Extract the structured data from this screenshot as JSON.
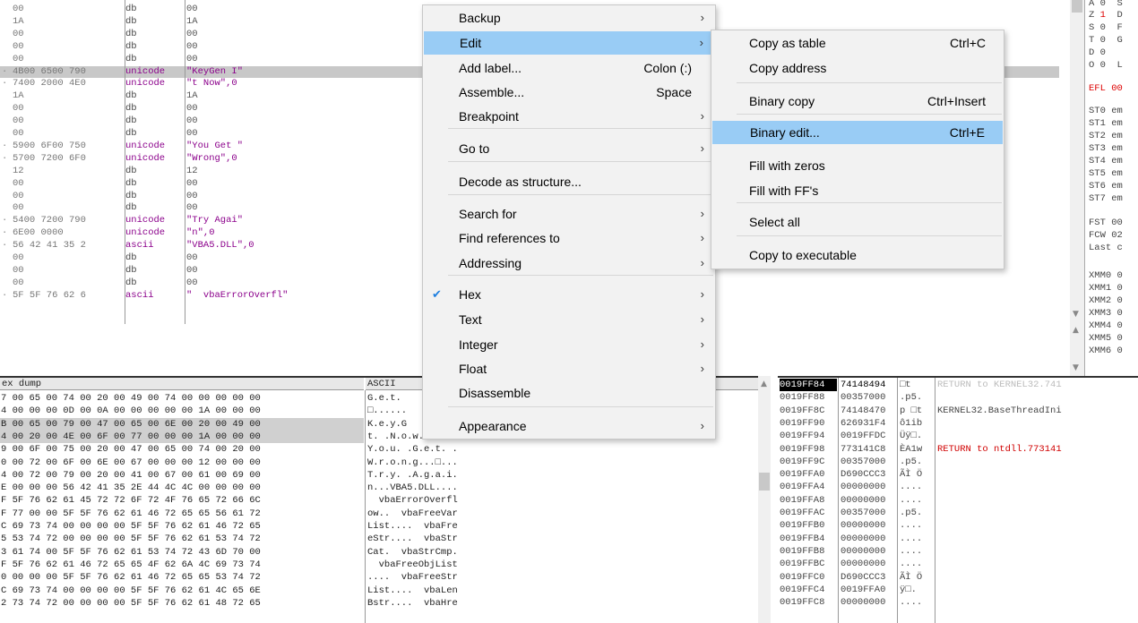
{
  "disasm": {
    "rows": [
      {
        "a": "00",
        "b": "db",
        "c": "00",
        "sel": false,
        "dot": false
      },
      {
        "a": "1A",
        "b": "db",
        "c": "1A",
        "sel": false,
        "dot": false
      },
      {
        "a": "00",
        "b": "db",
        "c": "00",
        "sel": false,
        "dot": false
      },
      {
        "a": "00",
        "b": "db",
        "c": "00",
        "sel": false,
        "dot": false
      },
      {
        "a": "00",
        "b": "db",
        "c": "00",
        "sel": false,
        "dot": false
      },
      {
        "a": "4B00 6500 790",
        "b": "unicode",
        "c": "\"KeyGen I\"",
        "sel": true,
        "dot": true
      },
      {
        "a": "7400 2000 4E0",
        "b": "unicode",
        "c": "\"t Now\",0",
        "sel": false,
        "dot": true
      },
      {
        "a": "1A",
        "b": "db",
        "c": "1A",
        "sel": false,
        "dot": false
      },
      {
        "a": "00",
        "b": "db",
        "c": "00",
        "sel": false,
        "dot": false
      },
      {
        "a": "00",
        "b": "db",
        "c": "00",
        "sel": false,
        "dot": false
      },
      {
        "a": "00",
        "b": "db",
        "c": "00",
        "sel": false,
        "dot": false
      },
      {
        "a": "5900 6F00 750",
        "b": "unicode",
        "c": "\"You Get \"",
        "sel": false,
        "dot": true
      },
      {
        "a": "5700 7200 6F0",
        "b": "unicode",
        "c": "\"Wrong\",0",
        "sel": false,
        "dot": true
      },
      {
        "a": "12",
        "b": "db",
        "c": "12",
        "sel": false,
        "dot": false
      },
      {
        "a": "00",
        "b": "db",
        "c": "00",
        "sel": false,
        "dot": false
      },
      {
        "a": "00",
        "b": "db",
        "c": "00",
        "sel": false,
        "dot": false
      },
      {
        "a": "00",
        "b": "db",
        "c": "00",
        "sel": false,
        "dot": false
      },
      {
        "a": "5400 7200 790",
        "b": "unicode",
        "c": "\"Try Agai\"",
        "sel": false,
        "dot": true
      },
      {
        "a": "6E00 0000",
        "b": "unicode",
        "c": "\"n\",0",
        "sel": false,
        "dot": true
      },
      {
        "a": "56 42 41 35 2",
        "b": "ascii",
        "c": "\"VBA5.DLL\",0",
        "sel": false,
        "dot": true
      },
      {
        "a": "00",
        "b": "db",
        "c": "00",
        "sel": false,
        "dot": false
      },
      {
        "a": "00",
        "b": "db",
        "c": "00",
        "sel": false,
        "dot": false
      },
      {
        "a": "00",
        "b": "db",
        "c": "00",
        "sel": false,
        "dot": false
      },
      {
        "a": "5F 5F 76 62 6",
        "b": "ascii",
        "c": "\"  vbaErrorOverfl\"",
        "sel": false,
        "dot": true
      }
    ]
  },
  "registers": {
    "rows": [
      {
        "t": "A 0  S",
        "red": false
      },
      {
        "t": "Z 1  D",
        "red": false,
        "z": true
      },
      {
        "t": "S 0  F",
        "red": false
      },
      {
        "t": "T 0  G",
        "red": false
      },
      {
        "t": "D 0",
        "red": false
      },
      {
        "t": "O 0  L",
        "red": false
      },
      {
        "t": "EFL 00",
        "red": true
      },
      {
        "t": "ST0 em",
        "red": false
      },
      {
        "t": "ST1 em",
        "red": false
      },
      {
        "t": "ST2 em",
        "red": false
      },
      {
        "t": "ST3 em",
        "red": false
      },
      {
        "t": "ST4 em",
        "red": false
      },
      {
        "t": "ST5 em",
        "red": false
      },
      {
        "t": "ST6 em",
        "red": false
      },
      {
        "t": "ST7 em",
        "red": false
      },
      {
        "t": "FST 00",
        "red": false
      },
      {
        "t": "FCW 02",
        "red": false
      },
      {
        "t": "Last c",
        "red": false
      },
      {
        "t": "XMM0 0",
        "red": false
      },
      {
        "t": "XMM1 0",
        "red": false
      },
      {
        "t": "XMM2 0",
        "red": false
      },
      {
        "t": "XMM3 0",
        "red": false
      },
      {
        "t": "XMM4 0",
        "red": false
      },
      {
        "t": "XMM5 0",
        "red": false
      },
      {
        "t": "XMM6 0",
        "red": false
      }
    ]
  },
  "hexdump": {
    "header_hex": "ex dump",
    "header_ascii": "ASCII",
    "rows": [
      {
        "h": "7 00 65 00 74 00 20 00 49 00 74 00 00 00 00 00",
        "a": "G.e.t. ",
        "sel": false
      },
      {
        "h": "4 00 00 00 0D 00 0A 00 00 00 00 00 1A 00 00 00",
        "a": "□......",
        "sel": false
      },
      {
        "h": "B 00 65 00 79 00 47 00 65 00 6E 00 20 00 49 00",
        "a": "K.e.y.G",
        "sel": true
      },
      {
        "h": "4 00 20 00 4E 00 6F 00 77 00 00 00 1A 00 00 00",
        "a": "t. .N.o.w...□...",
        "sel": true
      },
      {
        "h": "9 00 6F 00 75 00 20 00 47 00 65 00 74 00 20 00",
        "a": "Y.o.u. .G.e.t. .",
        "sel": false
      },
      {
        "h": "0 00 72 00 6F 00 6E 00 67 00 00 00 12 00 00 00",
        "a": "W.r.o.n.g...□...",
        "sel": false
      },
      {
        "h": "4 00 72 00 79 00 20 00 41 00 67 00 61 00 69 00",
        "a": "T.r.y. .A.g.a.i.",
        "sel": false
      },
      {
        "h": "E 00 00 00 56 42 41 35 2E 44 4C 4C 00 00 00 00",
        "a": "n...VBA5.DLL....",
        "sel": false
      },
      {
        "h": "F 5F 76 62 61 45 72 72 6F 72 4F 76 65 72 66 6C",
        "a": "  vbaErrorOverfl",
        "sel": false
      },
      {
        "h": "F 77 00 00 5F 5F 76 62 61 46 72 65 65 56 61 72",
        "a": "ow..  vbaFreeVar",
        "sel": false
      },
      {
        "h": "C 69 73 74 00 00 00 00 5F 5F 76 62 61 46 72 65",
        "a": "List....  vbaFre",
        "sel": false
      },
      {
        "h": "5 53 74 72 00 00 00 00 5F 5F 76 62 61 53 74 72",
        "a": "eStr....  vbaStr",
        "sel": false
      },
      {
        "h": "3 61 74 00 5F 5F 76 62 61 53 74 72 43 6D 70 00",
        "a": "Cat.  vbaStrCmp.",
        "sel": false
      },
      {
        "h": "F 5F 76 62 61 46 72 65 65 4F 62 6A 4C 69 73 74",
        "a": "  vbaFreeObjList",
        "sel": false
      },
      {
        "h": "0 00 00 00 5F 5F 76 62 61 46 72 65 65 53 74 72",
        "a": "....  vbaFreeStr",
        "sel": false
      },
      {
        "h": "C 69 73 74 00 00 00 00 5F 5F 76 62 61 4C 65 6E",
        "a": "List....  vbaLen",
        "sel": false
      },
      {
        "h": "2 73 74 72 00 00 00 00 5F 5F 76 62 61 48 72 65",
        "a": "Bstr....  vbaHre",
        "sel": false
      }
    ]
  },
  "stack": {
    "rows": [
      {
        "addr": "0019FF84",
        "val": "74148494",
        "asc": "□t",
        "com": "RETURN to KERNEL32.741",
        "cls": "gray",
        "cur": true
      },
      {
        "addr": "0019FF88",
        "val": "00357000",
        "asc": ".p5.",
        "com": "",
        "cls": ""
      },
      {
        "addr": "0019FF8C",
        "val": "74148470",
        "asc": "p □t",
        "com": "KERNEL32.BaseThreadIni",
        "cls": ""
      },
      {
        "addr": "0019FF90",
        "val": "626931F4",
        "asc": "ô1ib",
        "com": "",
        "cls": ""
      },
      {
        "addr": "0019FF94",
        "val": "0019FFDC",
        "asc": "Üÿ□.",
        "com": "",
        "cls": ""
      },
      {
        "addr": "0019FF98",
        "val": "773141C8",
        "asc": "ÈA1w",
        "com": "RETURN to ntdll.773141",
        "cls": "red"
      },
      {
        "addr": "0019FF9C",
        "val": "00357000",
        "asc": ".p5.",
        "com": "",
        "cls": ""
      },
      {
        "addr": "0019FFA0",
        "val": "D690CCC3",
        "asc": "ÃÌ Ö",
        "com": "",
        "cls": ""
      },
      {
        "addr": "0019FFA4",
        "val": "00000000",
        "asc": "....",
        "com": "",
        "cls": ""
      },
      {
        "addr": "0019FFA8",
        "val": "00000000",
        "asc": "....",
        "com": "",
        "cls": ""
      },
      {
        "addr": "0019FFAC",
        "val": "00357000",
        "asc": ".p5.",
        "com": "",
        "cls": ""
      },
      {
        "addr": "0019FFB0",
        "val": "00000000",
        "asc": "....",
        "com": "",
        "cls": ""
      },
      {
        "addr": "0019FFB4",
        "val": "00000000",
        "asc": "....",
        "com": "",
        "cls": ""
      },
      {
        "addr": "0019FFB8",
        "val": "00000000",
        "asc": "....",
        "com": "",
        "cls": ""
      },
      {
        "addr": "0019FFBC",
        "val": "00000000",
        "asc": "....",
        "com": "",
        "cls": ""
      },
      {
        "addr": "0019FFC0",
        "val": "D690CCC3",
        "asc": "ÃÌ Ö",
        "com": "",
        "cls": ""
      },
      {
        "addr": "0019FFC4",
        "val": "0019FFA0",
        "asc": "ÿ□.",
        "com": "",
        "cls": ""
      },
      {
        "addr": "0019FFC8",
        "val": "00000000",
        "asc": "....",
        "com": "",
        "cls": ""
      }
    ]
  },
  "context_menu": {
    "items": [
      {
        "label": "Backup",
        "shortcut": "",
        "sub": true
      },
      {
        "label": "Edit",
        "shortcut": "",
        "sub": true,
        "hl": true
      },
      {
        "label": "Add label...",
        "shortcut": "Colon (:)",
        "sub": false
      },
      {
        "label": "Assemble...",
        "shortcut": "Space",
        "sub": false
      },
      {
        "label": "Breakpoint",
        "shortcut": "",
        "sub": true
      },
      {
        "label": "Go to",
        "shortcut": "",
        "sub": true
      },
      {
        "label": "Decode as structure...",
        "shortcut": "",
        "sub": false
      },
      {
        "label": "Search for",
        "shortcut": "",
        "sub": true
      },
      {
        "label": "Find references to",
        "shortcut": "",
        "sub": true
      },
      {
        "label": "Addressing",
        "shortcut": "",
        "sub": true
      },
      {
        "label": "Hex",
        "shortcut": "",
        "sub": true,
        "checked": true
      },
      {
        "label": "Text",
        "shortcut": "",
        "sub": true
      },
      {
        "label": "Integer",
        "shortcut": "",
        "sub": true
      },
      {
        "label": "Float",
        "shortcut": "",
        "sub": true
      },
      {
        "label": "Disassemble",
        "shortcut": "",
        "sub": false
      },
      {
        "label": "Appearance",
        "shortcut": "",
        "sub": true
      }
    ]
  },
  "edit_submenu": {
    "items": [
      {
        "label": "Copy as table",
        "shortcut": "Ctrl+C"
      },
      {
        "label": "Copy address",
        "shortcut": ""
      },
      {
        "label": "Binary copy",
        "shortcut": "Ctrl+Insert"
      },
      {
        "label": "Binary edit...",
        "shortcut": "Ctrl+E",
        "hl": true
      },
      {
        "label": "Fill with zeros",
        "shortcut": ""
      },
      {
        "label": "Fill with FF's",
        "shortcut": ""
      },
      {
        "label": "Select all",
        "shortcut": ""
      },
      {
        "label": "Copy to executable",
        "shortcut": ""
      }
    ]
  },
  "colors": {
    "highlight": "#99ccf5",
    "return_red": "#d00000",
    "unicode_purple": "#8b008b"
  }
}
